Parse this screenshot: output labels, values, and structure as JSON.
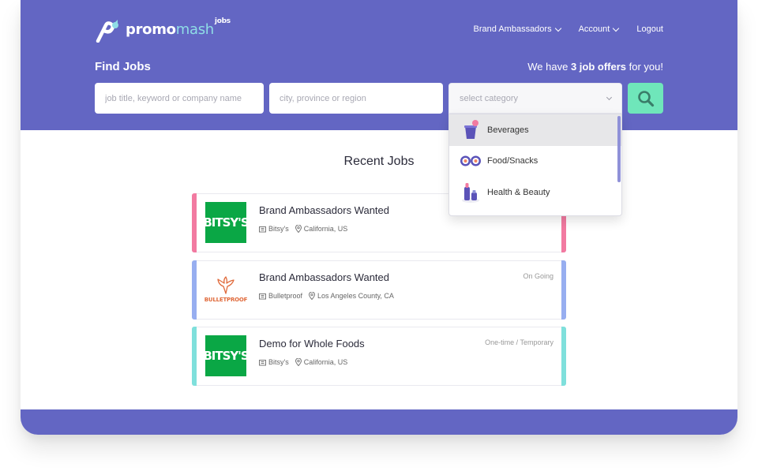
{
  "brand": {
    "promo": "promo",
    "mash": "mash",
    "jobs": "jobs"
  },
  "nav": {
    "items": [
      {
        "label": "Brand Ambassadors",
        "dropdown": true
      },
      {
        "label": "Account",
        "dropdown": true
      },
      {
        "label": "Logout",
        "dropdown": false
      }
    ]
  },
  "search": {
    "title": "Find Jobs",
    "offers_prefix": "We have ",
    "offers_count": "3 job offers",
    "offers_suffix": " for you!",
    "keyword_placeholder": "job title, keyword or company name",
    "location_placeholder": "city, province or region",
    "category_placeholder": "select category",
    "categories": [
      {
        "label": "Beverages",
        "icon": "beverage-cup-icon",
        "active": true
      },
      {
        "label": "Food/Snacks",
        "icon": "sushi-icon",
        "active": false
      },
      {
        "label": "Health & Beauty",
        "icon": "cosmetics-icon",
        "active": false
      }
    ]
  },
  "recent": {
    "title": "Recent Jobs"
  },
  "jobs": [
    {
      "title": "Brand Ambassadors Wanted",
      "company": "Bitsy's",
      "location": "California, US",
      "type": "",
      "logo": "BITSY'S",
      "color": "#f27aa1"
    },
    {
      "title": "Brand Ambassadors Wanted",
      "company": "Bulletproof",
      "location": "Los Angeles County, CA",
      "type": "On Going",
      "logo": "BULLETPROOF",
      "color": "#97aef0"
    },
    {
      "title": "Demo for Whole Foods",
      "company": "Bitsy's",
      "location": "California, US",
      "type": "One-time / Temporary",
      "logo": "BITSY'S",
      "color": "#7fe0dc"
    }
  ],
  "colors": {
    "header": "#6366c3",
    "accent": "#6fe6ba",
    "mash": "#8fdde6"
  }
}
